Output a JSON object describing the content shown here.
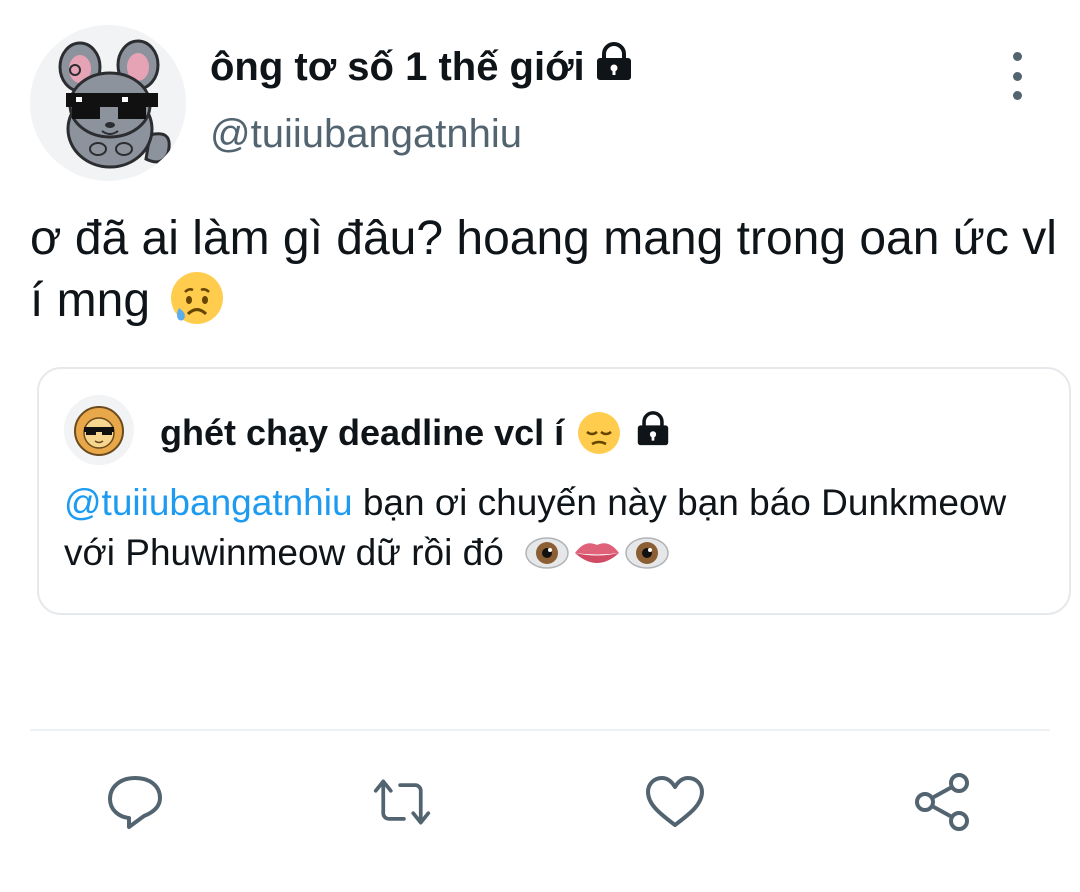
{
  "tweet": {
    "author": {
      "display_name": "ông tơ số 1 thế giới",
      "handle": "@tuiiubangatnhiu",
      "protected": true,
      "avatar_icon": "chinchilla-sunglasses-avatar"
    },
    "text": "ơ đã ai làm gì đâu? hoang mang trong oan ức vl í mng",
    "text_emoji": "sad-but-relieved-face-emoji",
    "quoted": {
      "display_name": "ghét chạy deadline vcl í",
      "name_emoji": "pensive-face-emoji",
      "protected": true,
      "avatar_icon": "lion-sunglasses-avatar",
      "mention": "@tuiiubangatnhiu",
      "text": " bạn ơi chuyến này bạn báo Dunkmeow với Phuwinmeow dữ rồi đó",
      "trailing_emojis": [
        "eye-emoji",
        "lips-emoji",
        "eye-emoji"
      ]
    }
  },
  "actions": [
    "reply-icon",
    "retweet-icon",
    "like-icon",
    "share-icon"
  ],
  "colors": {
    "text": "#0f1419",
    "secondary": "#536471",
    "link": "#1d9bf0",
    "border": "#e6e9ec"
  }
}
